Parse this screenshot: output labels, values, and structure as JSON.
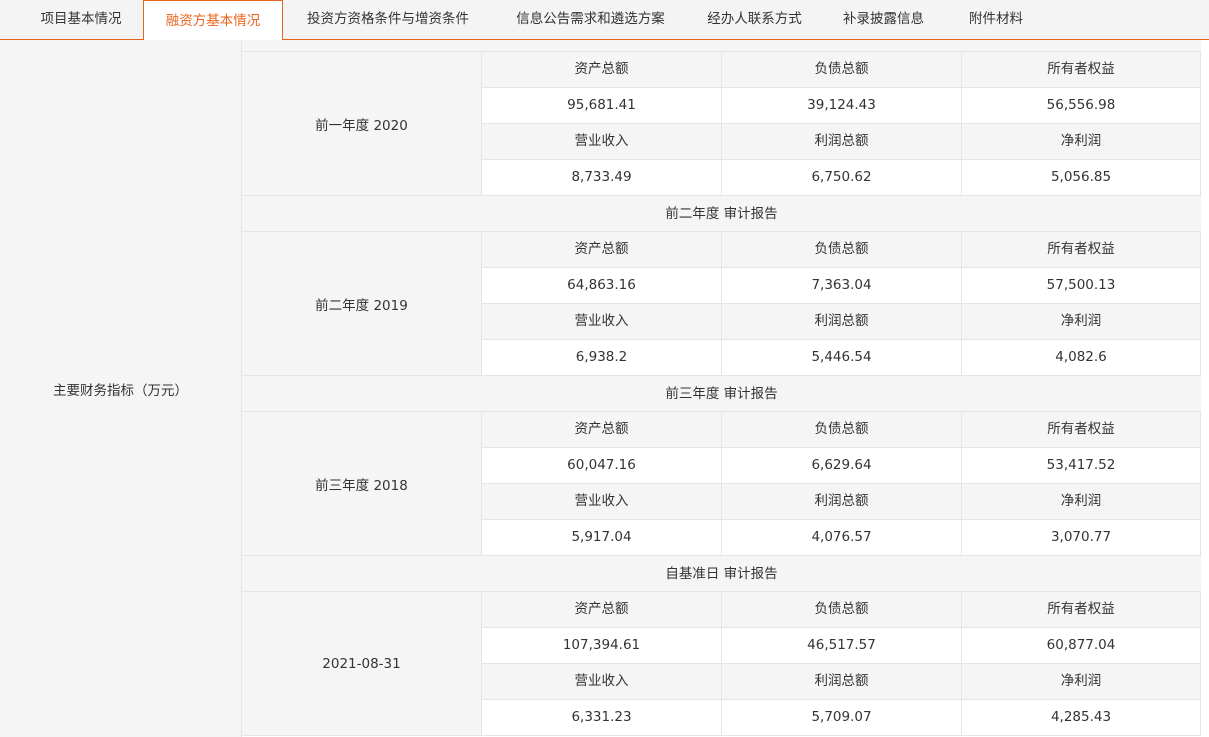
{
  "tabs": [
    {
      "label": "项目基本情况"
    },
    {
      "label": "融资方基本情况"
    },
    {
      "label": "投资方资格条件与增资条件"
    },
    {
      "label": "信息公告需求和遴选方案"
    },
    {
      "label": "经办人联系方式"
    },
    {
      "label": "补录披露信息"
    },
    {
      "label": "附件材料"
    }
  ],
  "active_tab": "融资方基本情况",
  "accent_color": "#e8641e",
  "row_label": "主要财务指标（万元）",
  "metric_headers": {
    "row1": [
      "资产总额",
      "负债总额",
      "所有者权益"
    ],
    "row2": [
      "营业收入",
      "利润总额",
      "净利润"
    ]
  },
  "periods": [
    {
      "section": "",
      "label": "前一年度 2020",
      "row1": [
        "95,681.41",
        "39,124.43",
        "56,556.98"
      ],
      "row2": [
        "8,733.49",
        "6,750.62",
        "5,056.85"
      ]
    },
    {
      "section": "前二年度 审计报告",
      "label": "前二年度 2019",
      "row1": [
        "64,863.16",
        "7,363.04",
        "57,500.13"
      ],
      "row2": [
        "6,938.2",
        "5,446.54",
        "4,082.6"
      ]
    },
    {
      "section": "前三年度 审计报告",
      "label": "前三年度 2018",
      "row1": [
        "60,047.16",
        "6,629.64",
        "53,417.52"
      ],
      "row2": [
        "5,917.04",
        "4,076.57",
        "3,070.77"
      ]
    },
    {
      "section": "自基准日 审计报告",
      "label": "2021-08-31",
      "row1": [
        "107,394.61",
        "46,517.57",
        "60,877.04"
      ],
      "row2": [
        "6,331.23",
        "5,709.07",
        "4,285.43"
      ]
    }
  ]
}
